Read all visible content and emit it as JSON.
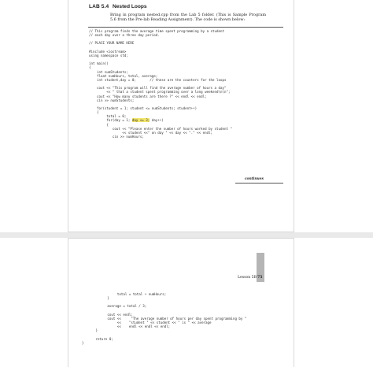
{
  "header": {
    "lab_number": "LAB 5.4",
    "lab_title": "Nested Loops",
    "intro": "Bring in program nested.cpp from the Lab 5 folder. (This is Sample Program 5.6 from the Pre-lab Reading Assignment). The code is shown below:"
  },
  "code_page1": [
    "// This program finds the average time spent programming by a student",
    "// each day over a three day period.",
    "",
    "// PLACE YOUR NAME HERE",
    "",
    "#include <iostream>",
    "using namespace std;",
    "",
    "int main()",
    "{",
    "    int numStudents;",
    "    float numHours, total, average;",
    "    int student,day = 0;       // these are the counters for the loops",
    "",
    "    cout << \"This program will find the average number of hours a day\"",
    "         << \" that a student spent programming over a long weekend\\n\\n\";",
    "    cout << \"How many students are there ?\" << endl << endl;",
    "    cin >> numStudents;",
    "",
    "    for(student = 1; student <= numStudents; student++)",
    "    {",
    "         total = 0;",
    "         for(day = 1; "
  ],
  "highlighted_code": "day <= 3;",
  "code_line_after_highlight": " day++)",
  "code_page1_tail": [
    "         {",
    "            cout << \"Please enter the number of hours worked by student \"",
    "                 << student <<\" on day \" << day << \".\" << endl;",
    "            cin >> numHours;"
  ],
  "continues_label": "continues",
  "footer": {
    "lesson": "Lesson 5B",
    "page_number": "75"
  },
  "code_page2": [
    "                  total = total + numHours;",
    "             }",
    "",
    "             average = total / 3;",
    "",
    "             cout << endl;",
    "             cout <<     \"The average number of hours per day spent programming by \"",
    "                  <<    \"student \" << student << \" is \" << average",
    "                  <<    endl << endl << endl;",
    "       }",
    "",
    "       return 0;",
    "}"
  ]
}
